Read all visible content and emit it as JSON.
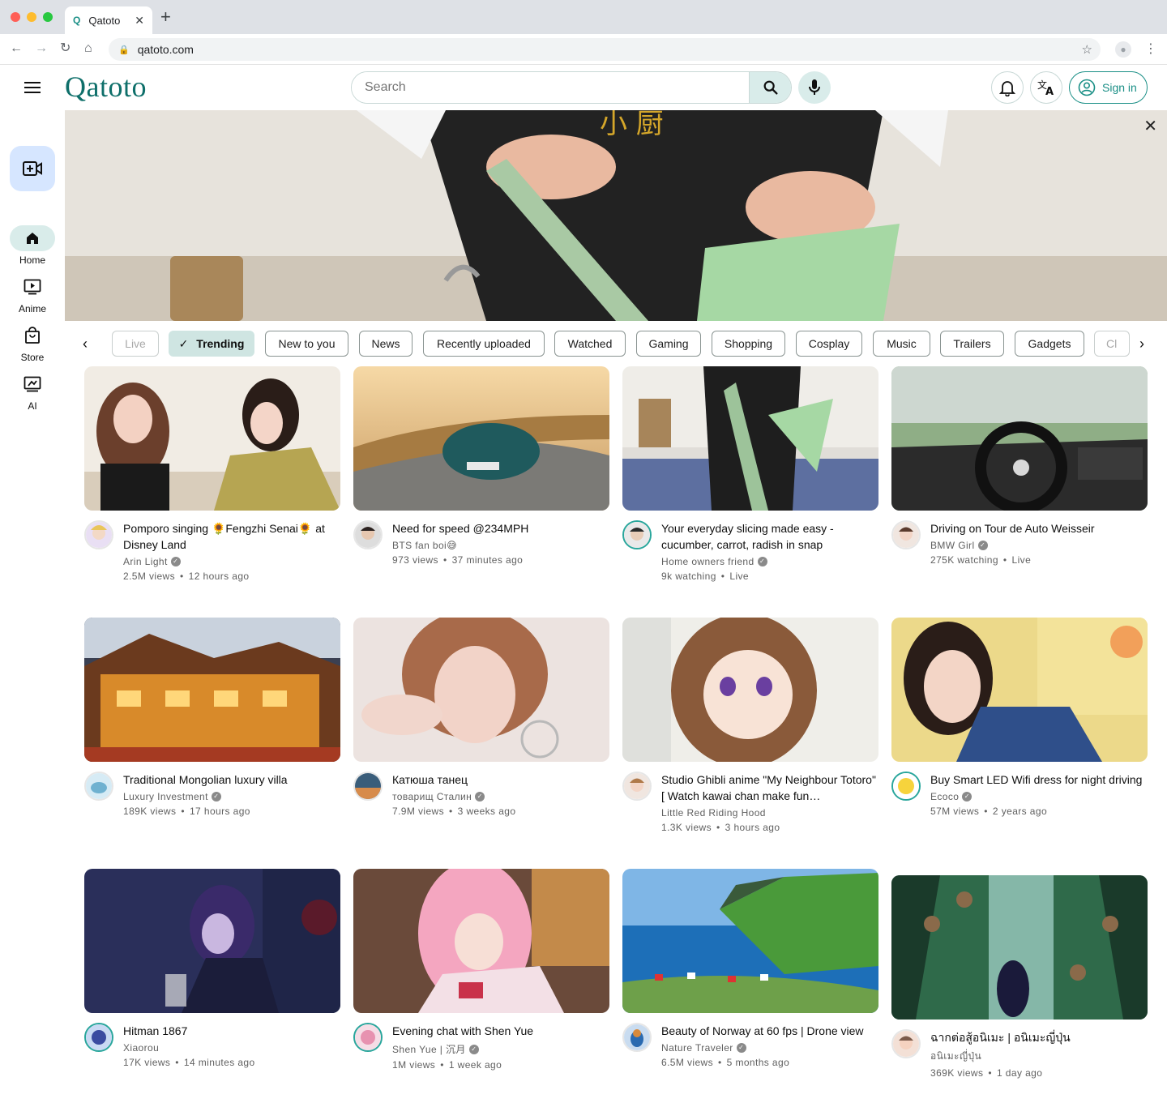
{
  "browser": {
    "tab_title": "Qatoto",
    "tab_favicon": "Q",
    "url": "qatoto.com"
  },
  "header": {
    "logo": "Qatoto",
    "search_placeholder": "Search",
    "sign_in": "Sign in"
  },
  "sidebar": {
    "items": [
      {
        "label": "Home",
        "icon": "home-icon"
      },
      {
        "label": "Anime",
        "icon": "play-screen-icon"
      },
      {
        "label": "Store",
        "icon": "shopping-bag-icon"
      },
      {
        "label": "AI",
        "icon": "ai-screen-icon"
      }
    ]
  },
  "chips": [
    "Live",
    "Trending",
    "New to you",
    "News",
    "Recently uploaded",
    "Watched",
    "Gaming",
    "Shopping",
    "Cosplay",
    "Music",
    "Trailers",
    "Gadgets",
    "Cl"
  ],
  "active_chip": "Trending",
  "videos": [
    {
      "title": "Pomporo singing 🌻Fengzhi Senai🌻 at Disney Land",
      "channel": "Arin Light",
      "verified": true,
      "views": "2.5M views",
      "time": "12 hours ago"
    },
    {
      "title": "Need for speed @234MPH",
      "channel": "BTS fan boi😅",
      "verified": false,
      "views": "973 views",
      "time": "37 minutes ago"
    },
    {
      "title": "Your everyday slicing made easy - cucumber, carrot, radish in snap",
      "channel": "Home owners friend",
      "verified": true,
      "views": "9k watching",
      "time": "Live"
    },
    {
      "title": "Driving on Tour de Auto Weisseir",
      "channel": "BMW Girl",
      "verified": true,
      "views": "275K watching",
      "time": "Live"
    },
    {
      "title": "Traditional Mongolian luxury villa",
      "channel": "Luxury Investment",
      "verified": true,
      "views": "189K views",
      "time": "17 hours ago"
    },
    {
      "title": "Катюша танец",
      "channel": "товарищ Сталин",
      "verified": true,
      "views": "7.9M views",
      "time": "3 weeks ago"
    },
    {
      "title": "Studio Ghibli anime \"My Neighbour Totoro\" [ Watch kawai chan make fun…",
      "channel": "Little Red Riding Hood",
      "verified": false,
      "views": "1.3K views",
      "time": "3 hours ago"
    },
    {
      "title": "Buy Smart LED Wifi dress for night driving",
      "channel": "Ecoco",
      "verified": true,
      "views": "57M views",
      "time": "2 years ago"
    },
    {
      "title": "Hitman 1867",
      "channel": "Xiaorou",
      "verified": false,
      "views": "17K views",
      "time": "14 minutes ago"
    },
    {
      "title": "Evening chat with Shen Yue",
      "channel": "Shen Yue | 沉月",
      "verified": true,
      "views": "1M views",
      "time": "1 week ago"
    },
    {
      "title": "Beauty of Norway at 60 fps | Drone view",
      "channel": "Nature Traveler",
      "verified": true,
      "views": "6.5M views",
      "time": "5 months ago"
    },
    {
      "title": "ฉากต่อสู้อนิเมะ | อนิเมะญี่ปุ่น",
      "channel": "อนิเมะญี่ปุ่น",
      "verified": false,
      "views": "369K views",
      "time": "1 day ago"
    }
  ],
  "colors": {
    "brand": "#0e6f6a",
    "accent": "#1a8f86",
    "chip_active": "#cfe5e2"
  }
}
